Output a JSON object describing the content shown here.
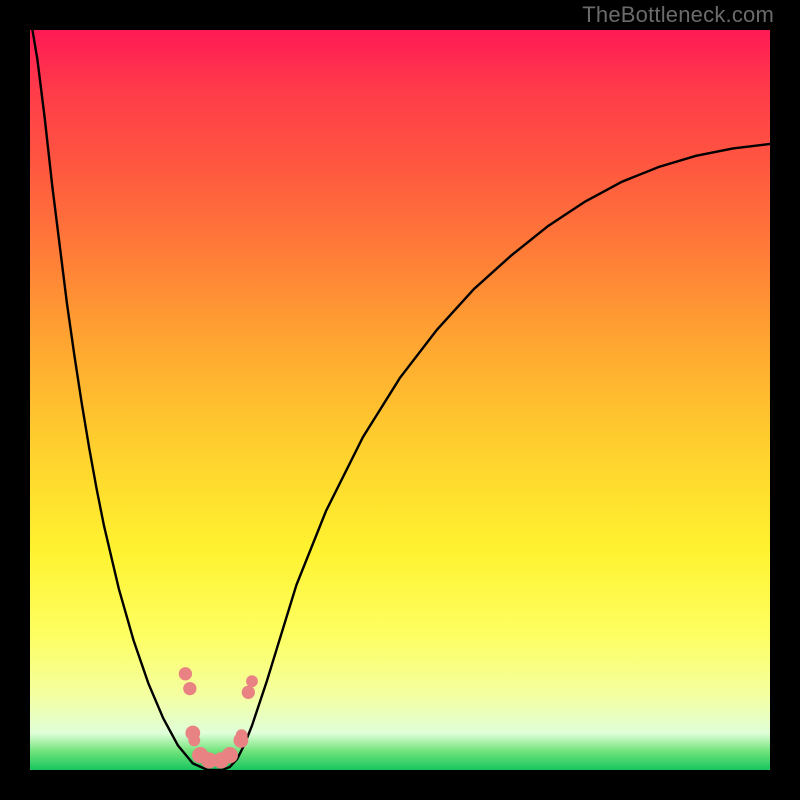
{
  "watermark": "TheBottleneck.com",
  "colors": {
    "frame": "#000000",
    "curve": "#000000",
    "marker": "#e98383",
    "gradient_top": "#ff1a55",
    "gradient_bottom": "#19c560"
  },
  "chart_data": {
    "type": "line",
    "title": "",
    "xlabel": "",
    "ylabel": "",
    "xlim": [
      0,
      100
    ],
    "ylim": [
      0,
      100
    ],
    "grid": false,
    "legend": false,
    "series": [
      {
        "name": "bottleneck-curve",
        "x": [
          0.0,
          0.5,
          1.0,
          1.5,
          2.0,
          2.5,
          3.0,
          4.0,
          5.0,
          6.0,
          7.0,
          8.0,
          9.0,
          10.0,
          12.0,
          14.0,
          16.0,
          18.0,
          20.0,
          22.0,
          24.0,
          25.0,
          26.0,
          27.0,
          28.0,
          29.0,
          30.0,
          32.0,
          34.0,
          36.0,
          40.0,
          45.0,
          50.0,
          55.0,
          60.0,
          65.0,
          70.0,
          75.0,
          80.0,
          85.0,
          90.0,
          95.0,
          100.0
        ],
        "y": [
          102,
          99.0,
          96.0,
          92.0,
          88.0,
          83.5,
          79.0,
          71.0,
          63.0,
          56.0,
          49.5,
          43.5,
          38.0,
          33.0,
          24.5,
          17.5,
          11.7,
          7.0,
          3.3,
          0.9,
          0.0,
          0.0,
          0.0,
          0.4,
          1.5,
          3.5,
          6.0,
          12.0,
          18.5,
          25.0,
          35.0,
          45.0,
          53.0,
          59.5,
          65.0,
          69.5,
          73.5,
          76.8,
          79.5,
          81.5,
          83.0,
          84.0,
          84.6
        ]
      }
    ],
    "markers": [
      {
        "x": 21.0,
        "y": 13.0,
        "r": 0.9
      },
      {
        "x": 21.6,
        "y": 11.0,
        "r": 0.9
      },
      {
        "x": 22.0,
        "y": 5.0,
        "r": 1.0
      },
      {
        "x": 22.2,
        "y": 4.0,
        "r": 0.8
      },
      {
        "x": 23.0,
        "y": 2.0,
        "r": 1.1
      },
      {
        "x": 24.2,
        "y": 1.3,
        "r": 1.1
      },
      {
        "x": 25.8,
        "y": 1.3,
        "r": 1.1
      },
      {
        "x": 27.0,
        "y": 2.0,
        "r": 1.1
      },
      {
        "x": 28.5,
        "y": 4.0,
        "r": 1.0
      },
      {
        "x": 28.6,
        "y": 4.7,
        "r": 0.8
      },
      {
        "x": 29.5,
        "y": 10.5,
        "r": 0.9
      },
      {
        "x": 30.0,
        "y": 12.0,
        "r": 0.8
      }
    ]
  }
}
